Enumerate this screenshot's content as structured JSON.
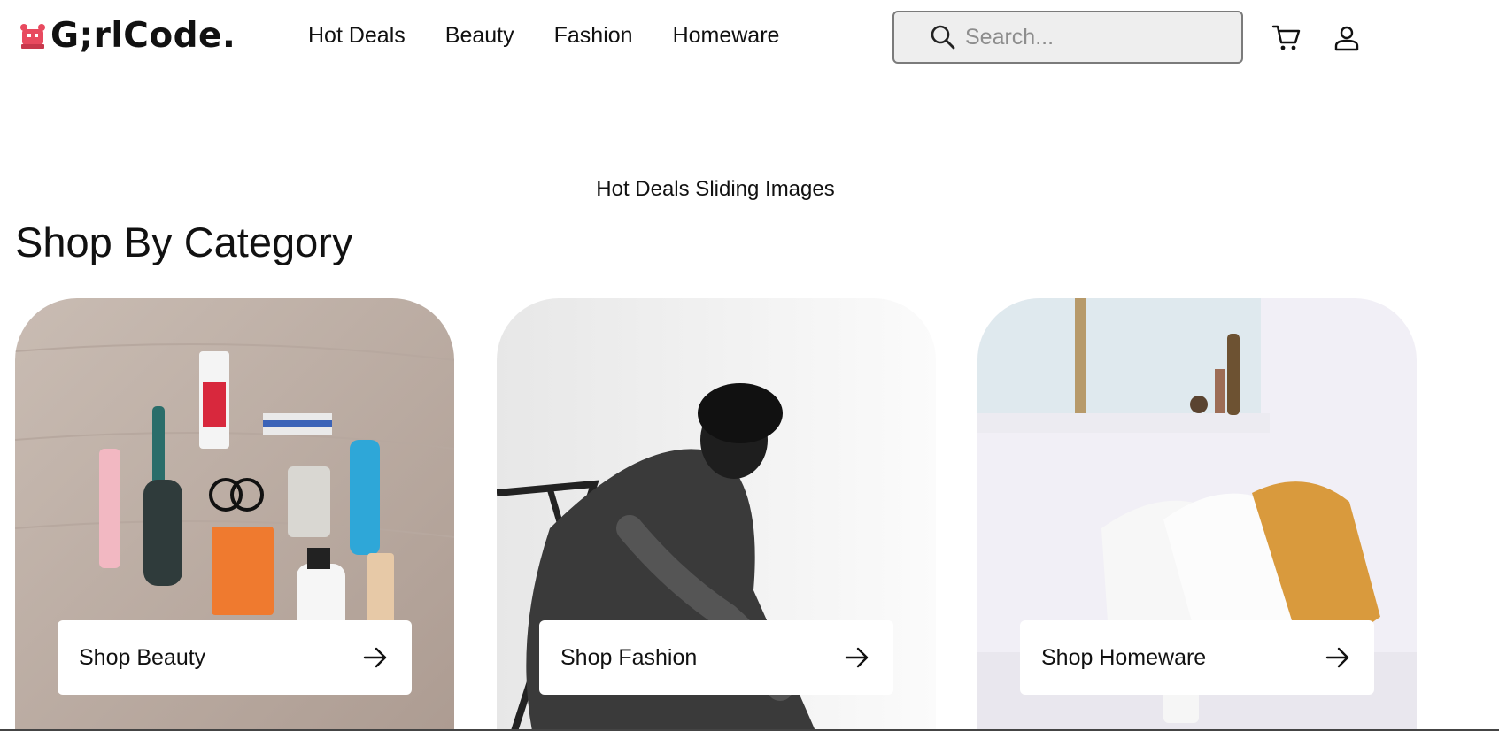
{
  "brand": {
    "logo_text": "G;rlCode.",
    "accent": "#e84a5f"
  },
  "nav": {
    "items": [
      {
        "label": "Hot Deals"
      },
      {
        "label": "Beauty"
      },
      {
        "label": "Fashion"
      },
      {
        "label": "Homeware"
      }
    ]
  },
  "search": {
    "placeholder": "Search...",
    "value": "",
    "icon": "search-icon"
  },
  "header_icons": {
    "cart": "cart-icon",
    "account": "user-icon"
  },
  "hero": {
    "caption": "Hot Deals Sliding Images"
  },
  "categories": {
    "title": "Shop By Category",
    "cards": [
      {
        "label": "Shop Beauty",
        "image": "beauty toiletries flat lay on wooden surface",
        "icon": "arrow-right-icon"
      },
      {
        "label": "Shop Fashion",
        "image": "black and white photo of man in denim jacket on chair",
        "icon": "arrow-right-icon"
      },
      {
        "label": "Shop Homeware",
        "image": "bright bedroom with pillows by a window",
        "icon": "arrow-right-icon"
      }
    ]
  }
}
